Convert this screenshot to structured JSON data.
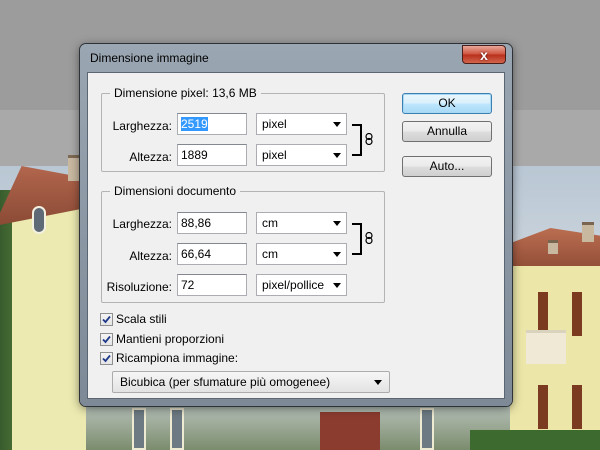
{
  "dialog": {
    "title": "Dimensione immagine",
    "close_label": "x"
  },
  "pixel_dimensions": {
    "legend": "Dimensione pixel:",
    "size": "13,6 MB",
    "width_label": "Larghezza:",
    "width_value": "2519",
    "width_unit": "pixel",
    "height_label": "Altezza:",
    "height_value": "1889",
    "height_unit": "pixel"
  },
  "document_size": {
    "legend": "Dimensioni documento",
    "width_label": "Larghezza:",
    "width_value": "88,86",
    "width_unit": "cm",
    "height_label": "Altezza:",
    "height_value": "66,64",
    "height_unit": "cm",
    "resolution_label": "Risoluzione:",
    "resolution_value": "72",
    "resolution_unit": "pixel/pollice"
  },
  "buttons": {
    "ok": "OK",
    "cancel": "Annulla",
    "auto": "Auto..."
  },
  "options": {
    "scale_styles": {
      "label": "Scala stili",
      "checked": true
    },
    "constrain": {
      "label": "Mantieni proporzioni",
      "checked": true
    },
    "resample": {
      "label": "Ricampiona immagine:",
      "checked": true
    },
    "resample_method": "Bicubica (per sfumature più omogenee)"
  },
  "icons": {
    "link": "chain-link-icon",
    "close": "close-icon",
    "dropdown": "chevron-down-icon",
    "check": "checkmark-icon"
  },
  "colors": {
    "selection": "#3399ff",
    "close_button": "#c9432c",
    "default_button_border": "#3c7fb1"
  }
}
